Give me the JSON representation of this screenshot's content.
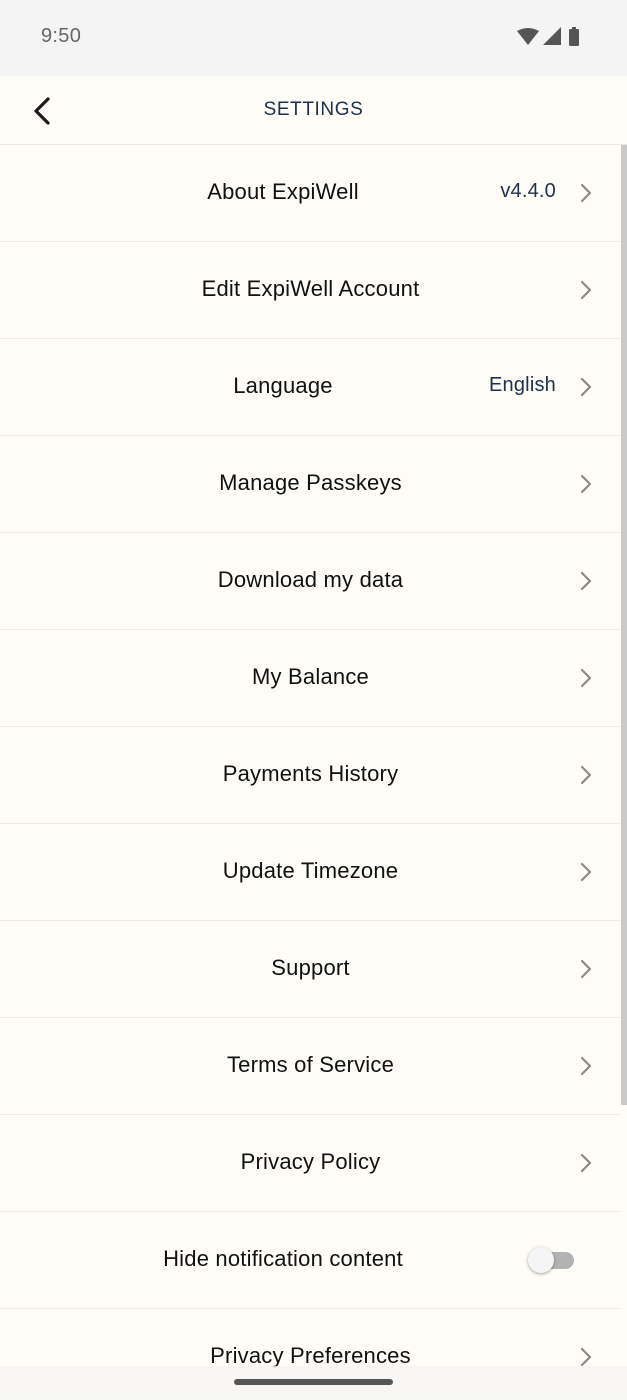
{
  "status_bar": {
    "time": "9:50",
    "icons": [
      "wifi-icon",
      "cellular-signal-icon",
      "battery-icon"
    ]
  },
  "header": {
    "title": "SETTINGS",
    "back_icon": "chevron-left-icon"
  },
  "settings": {
    "items": [
      {
        "label": "About ExpiWell",
        "value": "v4.4.0",
        "control": "chevron"
      },
      {
        "label": "Edit ExpiWell Account",
        "control": "chevron"
      },
      {
        "label": "Language",
        "value": "English",
        "control": "chevron"
      },
      {
        "label": "Manage Passkeys",
        "control": "chevron"
      },
      {
        "label": "Download my data",
        "control": "chevron"
      },
      {
        "label": "My Balance",
        "control": "chevron"
      },
      {
        "label": "Payments History",
        "control": "chevron"
      },
      {
        "label": "Update Timezone",
        "control": "chevron"
      },
      {
        "label": "Support",
        "control": "chevron"
      },
      {
        "label": "Terms of Service",
        "control": "chevron"
      },
      {
        "label": "Privacy Policy",
        "control": "chevron"
      },
      {
        "label": "Hide notification content",
        "control": "toggle",
        "toggle_on": false
      },
      {
        "label": "Privacy Preferences",
        "control": "chevron"
      }
    ]
  },
  "colors": {
    "background": "#fdfcf6",
    "header_text": "#1f3148",
    "value_text": "#1f3148",
    "chevron": "#8a8a8a",
    "toggle_track_off": "#b3b3b3"
  }
}
